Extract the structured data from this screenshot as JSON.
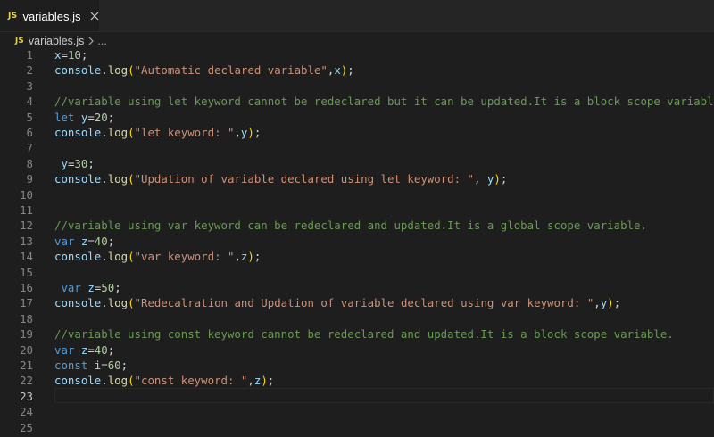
{
  "tab": {
    "badge": "JS",
    "label": "variables.js"
  },
  "breadcrumb": {
    "badge": "JS",
    "file": "variables.js",
    "more": "..."
  },
  "editor": {
    "active_line": 23,
    "lines": [
      {
        "num": "1",
        "tokens": [
          [
            "var",
            "x"
          ],
          [
            "pun",
            "="
          ],
          [
            "num",
            "10"
          ],
          [
            "pun",
            ";"
          ]
        ]
      },
      {
        "num": "2",
        "tokens": [
          [
            "var",
            "console"
          ],
          [
            "pun",
            "."
          ],
          [
            "fn",
            "log"
          ],
          [
            "par",
            "("
          ],
          [
            "str",
            "\"Automatic declared variable\""
          ],
          [
            "pun",
            ","
          ],
          [
            "var",
            "x"
          ],
          [
            "par",
            ")"
          ],
          [
            "pun",
            ";"
          ]
        ]
      },
      {
        "num": "3",
        "tokens": []
      },
      {
        "num": "4",
        "tokens": [
          [
            "com",
            "//variable using let keyword cannot be redeclared but it can be updated.It is a block scope variable."
          ]
        ]
      },
      {
        "num": "5",
        "tokens": [
          [
            "kw",
            "let"
          ],
          [
            "pun",
            " "
          ],
          [
            "var",
            "y"
          ],
          [
            "pun",
            "="
          ],
          [
            "num",
            "20"
          ],
          [
            "pun",
            ";"
          ]
        ]
      },
      {
        "num": "6",
        "tokens": [
          [
            "var",
            "console"
          ],
          [
            "pun",
            "."
          ],
          [
            "fn",
            "log"
          ],
          [
            "par",
            "("
          ],
          [
            "str",
            "\"let keyword: \""
          ],
          [
            "pun",
            ","
          ],
          [
            "var",
            "y"
          ],
          [
            "par",
            ")"
          ],
          [
            "pun",
            ";"
          ]
        ]
      },
      {
        "num": "7",
        "tokens": []
      },
      {
        "num": "8",
        "tokens": [
          [
            "pun",
            " "
          ],
          [
            "var",
            "y"
          ],
          [
            "pun",
            "="
          ],
          [
            "num",
            "30"
          ],
          [
            "pun",
            ";"
          ]
        ]
      },
      {
        "num": "9",
        "tokens": [
          [
            "var",
            "console"
          ],
          [
            "pun",
            "."
          ],
          [
            "fn",
            "log"
          ],
          [
            "par",
            "("
          ],
          [
            "str",
            "\"Updation of variable declared using let keyword: \""
          ],
          [
            "pun",
            ", "
          ],
          [
            "var",
            "y"
          ],
          [
            "par",
            ")"
          ],
          [
            "pun",
            ";"
          ]
        ]
      },
      {
        "num": "10",
        "tokens": []
      },
      {
        "num": "11",
        "tokens": []
      },
      {
        "num": "12",
        "tokens": [
          [
            "com",
            "//variable using var keyword can be redeclared and updated.It is a global scope variable."
          ]
        ]
      },
      {
        "num": "13",
        "tokens": [
          [
            "kw",
            "var"
          ],
          [
            "pun",
            " "
          ],
          [
            "var",
            "z"
          ],
          [
            "pun",
            "="
          ],
          [
            "num",
            "40"
          ],
          [
            "pun",
            ";"
          ]
        ]
      },
      {
        "num": "14",
        "tokens": [
          [
            "var",
            "console"
          ],
          [
            "pun",
            "."
          ],
          [
            "fn",
            "log"
          ],
          [
            "par",
            "("
          ],
          [
            "str",
            "\"var keyword: \""
          ],
          [
            "pun",
            ","
          ],
          [
            "var",
            "z"
          ],
          [
            "par",
            ")"
          ],
          [
            "pun",
            ";"
          ]
        ]
      },
      {
        "num": "15",
        "tokens": []
      },
      {
        "num": "16",
        "tokens": [
          [
            "pun",
            " "
          ],
          [
            "kw",
            "var"
          ],
          [
            "pun",
            " "
          ],
          [
            "var",
            "z"
          ],
          [
            "pun",
            "="
          ],
          [
            "num",
            "50"
          ],
          [
            "pun",
            ";"
          ]
        ]
      },
      {
        "num": "17",
        "tokens": [
          [
            "var",
            "console"
          ],
          [
            "pun",
            "."
          ],
          [
            "fn",
            "log"
          ],
          [
            "par",
            "("
          ],
          [
            "str",
            "\"Redecalration and Updation of variable declared using var keyword: \""
          ],
          [
            "pun",
            ","
          ],
          [
            "var",
            "y"
          ],
          [
            "par",
            ")"
          ],
          [
            "pun",
            ";"
          ]
        ]
      },
      {
        "num": "18",
        "tokens": []
      },
      {
        "num": "19",
        "tokens": [
          [
            "com",
            "//variable using const keyword cannot be redeclared and updated.It is a block scope variable."
          ]
        ]
      },
      {
        "num": "20",
        "tokens": [
          [
            "kw",
            "var"
          ],
          [
            "pun",
            " "
          ],
          [
            "var",
            "z"
          ],
          [
            "pun",
            "="
          ],
          [
            "num",
            "40"
          ],
          [
            "pun",
            ";"
          ]
        ]
      },
      {
        "num": "21",
        "tokens": [
          [
            "kw",
            "const"
          ],
          [
            "pun",
            " "
          ],
          [
            "var",
            "i"
          ],
          [
            "pun",
            "="
          ],
          [
            "num",
            "60"
          ],
          [
            "pun",
            ";"
          ]
        ]
      },
      {
        "num": "22",
        "tokens": [
          [
            "var",
            "console"
          ],
          [
            "pun",
            "."
          ],
          [
            "fn",
            "log"
          ],
          [
            "par",
            "("
          ],
          [
            "str",
            "\"const keyword: \""
          ],
          [
            "pun",
            ","
          ],
          [
            "var",
            "z"
          ],
          [
            "par",
            ")"
          ],
          [
            "pun",
            ";"
          ]
        ]
      },
      {
        "num": "23",
        "tokens": []
      },
      {
        "num": "24",
        "tokens": []
      },
      {
        "num": "25",
        "tokens": []
      }
    ]
  },
  "icons": {
    "close": "close-icon",
    "chevron": "chevron-right-icon"
  },
  "colors": {
    "background": "#1e1e1e",
    "js_badge": "#e8d44d",
    "comment": "#6a9955",
    "string": "#ce9178",
    "keyword": "#569cd6",
    "variable": "#9cdcfe",
    "function": "#dcdcaa",
    "number": "#b5cea8",
    "bracket": "#ffd700"
  }
}
